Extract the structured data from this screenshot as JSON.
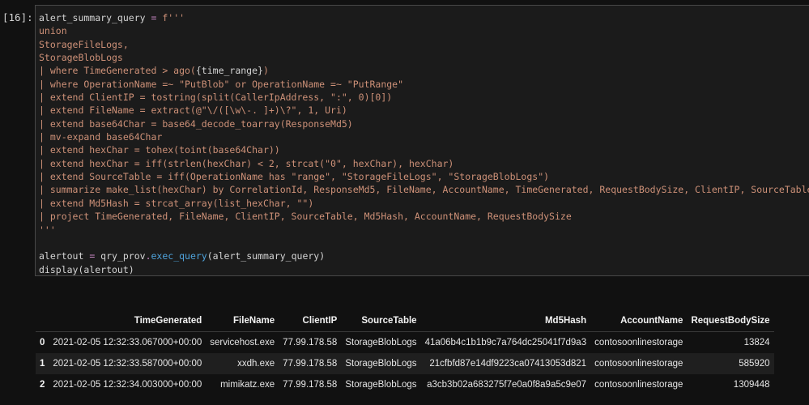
{
  "cell": {
    "prompt": "[16]:",
    "code_lines": [
      [
        {
          "t": "alert_summary_query ",
          "c": "plain"
        },
        {
          "t": "=",
          "c": "op"
        },
        {
          "t": " f'''",
          "c": "str"
        }
      ],
      [
        {
          "t": "union",
          "c": "str"
        }
      ],
      [
        {
          "t": "StorageFileLogs,",
          "c": "str"
        }
      ],
      [
        {
          "t": "StorageBlobLogs",
          "c": "str"
        }
      ],
      [
        {
          "t": "| where TimeGenerated > ago(",
          "c": "str"
        },
        {
          "t": "{time_range}",
          "c": "brace"
        },
        {
          "t": ")",
          "c": "str"
        }
      ],
      [
        {
          "t": "| where OperationName =~ \"PutBlob\" or OperationName =~ \"PutRange\"",
          "c": "str"
        }
      ],
      [
        {
          "t": "| extend ClientIP = tostring(split(CallerIpAddress, \":\", 0)[0])",
          "c": "str"
        }
      ],
      [
        {
          "t": "| extend FileName = extract(@\"\\/([\\w\\-. ]+)\\?\", 1, Uri)",
          "c": "str"
        }
      ],
      [
        {
          "t": "| extend base64Char = base64_decode_toarray(ResponseMd5)",
          "c": "str"
        }
      ],
      [
        {
          "t": "| mv-expand base64Char",
          "c": "str"
        }
      ],
      [
        {
          "t": "| extend hexChar = tohex(toint(base64Char))",
          "c": "str"
        }
      ],
      [
        {
          "t": "| extend hexChar = iff(strlen(hexChar) < 2, strcat(\"0\", hexChar), hexChar)",
          "c": "str"
        }
      ],
      [
        {
          "t": "| extend SourceTable = iff(OperationName has \"range\", \"StorageFileLogs\", \"StorageBlobLogs\")",
          "c": "str"
        }
      ],
      [
        {
          "t": "| summarize make_list(hexChar) by CorrelationId, ResponseMd5, FileName, AccountName, TimeGenerated, RequestBodySize, ClientIP, SourceTable",
          "c": "str"
        }
      ],
      [
        {
          "t": "| extend Md5Hash = strcat_array(list_hexChar, \"\")",
          "c": "str"
        }
      ],
      [
        {
          "t": "| project TimeGenerated, FileName, ClientIP, SourceTable, Md5Hash, AccountName, RequestBodySize",
          "c": "str"
        }
      ],
      [
        {
          "t": "'''",
          "c": "str"
        }
      ],
      [
        {
          "t": "",
          "c": "plain"
        }
      ],
      [
        {
          "t": "alertout ",
          "c": "plain"
        },
        {
          "t": "=",
          "c": "op"
        },
        {
          "t": " qry_prov",
          "c": "plain"
        },
        {
          "t": ".",
          "c": "op"
        },
        {
          "t": "exec_query",
          "c": "fn"
        },
        {
          "t": "(alert_summary_query)",
          "c": "plain"
        }
      ],
      [
        {
          "t": "display(alertout)",
          "c": "plain"
        }
      ]
    ]
  },
  "output": {
    "columns": [
      "",
      "TimeGenerated",
      "FileName",
      "ClientIP",
      "SourceTable",
      "Md5Hash",
      "AccountName",
      "RequestBodySize"
    ],
    "rows": [
      [
        "0",
        "2021-02-05 12:32:33.067000+00:00",
        "servicehost.exe",
        "77.99.178.58",
        "StorageBlobLogs",
        "41a06b4c1b1b9c7a764dc25041f7d9a3",
        "contosoonlinestorage",
        "13824"
      ],
      [
        "1",
        "2021-02-05 12:32:33.587000+00:00",
        "xxdh.exe",
        "77.99.178.58",
        "StorageBlobLogs",
        "21cfbfd87e14df9223ca07413053d821",
        "contosoonlinestorage",
        "585920"
      ],
      [
        "2",
        "2021-02-05 12:32:34.003000+00:00",
        "mimikatz.exe",
        "77.99.178.58",
        "StorageBlobLogs",
        "a3cb3b02a683275f7e0a0f8a9a5c9e07",
        "contosoonlinestorage",
        "1309448"
      ]
    ]
  },
  "colors": {
    "background": "#111111",
    "code_background": "#1b1b1b",
    "string": "#ce9178",
    "operator": "#c586c0",
    "function": "#4fa3dc",
    "plain": "#d4d4d4"
  }
}
